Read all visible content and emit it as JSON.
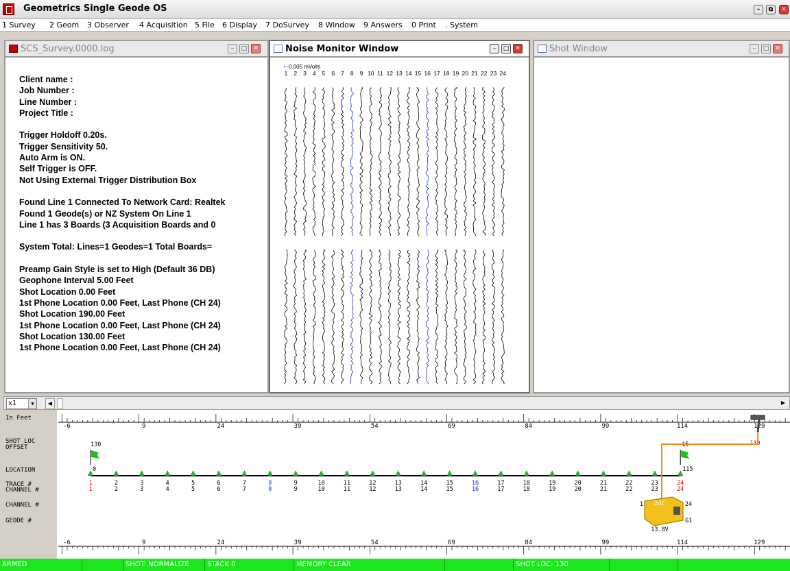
{
  "app": {
    "title": "Geometrics Single Geode OS",
    "controls": {
      "minimize": "–",
      "restore": "⧉",
      "close": "✕"
    }
  },
  "menu": [
    "1 Survey",
    "2 Geom",
    "3 Observer",
    "4 Acquisition",
    "5 File",
    "6 Display",
    "7 DoSurvey",
    "8 Window",
    "9 Answers",
    "0 Print",
    ". System"
  ],
  "windows": {
    "log": {
      "title": "SCS_Survey.0000.log",
      "lines": [
        "Client name  :",
        "Job Number  :",
        "Line Number  :",
        "Project Title  :",
        "",
        "Trigger Holdoff 0.20s.",
        "Trigger Sensitivity 50.",
        "Auto Arm is ON.",
        "Self Trigger is OFF.",
        "Not Using External Trigger Distribution Box",
        "",
        "Found Line 1 Connected To Network Card: Realtek",
        "Found 1 Geode(s) or NZ System On Line 1",
        "Line 1 has 3 Boards (3 Acquisition Boards and 0",
        "",
        "System Total: Lines=1  Geodes=1  Total Boards=",
        "",
        "Preamp Gain Style is set to High (Default 36 DB)",
        "Geophone Interval 5.00 Feet",
        "Shot Location 0.00 Feet",
        "1st Phone Location 0.00 Feet, Last Phone (CH 24)",
        "Shot Location 190.00 Feet",
        "1st Phone Location 0.00 Feet, Last Phone (CH 24)",
        "Shot Location 130.00 Feet",
        "1st Phone Location 0.00 Feet, Last Phone (CH 24)"
      ]
    },
    "noise": {
      "title": "Noise Monitor Window",
      "scale": "0.005 mVolts",
      "channels": [
        "1",
        "2",
        "3",
        "4",
        "5",
        "6",
        "7",
        "8",
        "9",
        "10",
        "11",
        "12",
        "13",
        "14",
        "15",
        "16",
        "17",
        "18",
        "19",
        "20",
        "21",
        "22",
        "23",
        "24"
      ],
      "highlight_channels": [
        "8",
        "16"
      ],
      "colors": {
        "trace": "#000000",
        "highlight": "#2233cc"
      }
    },
    "shot": {
      "title": "Shot Window"
    }
  },
  "geometry": {
    "zoom": "x1",
    "row_labels": {
      "units": "In Feet",
      "shot_loc": "SHOT LOC",
      "offset": "OFFSET",
      "location": "LOCATION",
      "trace": "TRACE #",
      "channel": "CHANNEL #",
      "channel2": "CHANNEL #",
      "geode": "GEODE #"
    },
    "ruler_ticks": [
      "-6",
      "9",
      "24",
      "39",
      "54",
      "69",
      "84",
      "99",
      "114",
      "129"
    ],
    "shot_offset_left": "130",
    "shot_location_left": "0",
    "shot_offset_right": "15",
    "shot_location_right": "115",
    "hammer_offset": "130",
    "traces": [
      "1",
      "2",
      "3",
      "4",
      "5",
      "6",
      "7",
      "8",
      "9",
      "10",
      "11",
      "12",
      "13",
      "14",
      "15",
      "16",
      "17",
      "18",
      "19",
      "20",
      "21",
      "22",
      "23",
      "24"
    ],
    "channels": [
      "1",
      "2",
      "3",
      "4",
      "5",
      "6",
      "7",
      "8",
      "9",
      "10",
      "11",
      "12",
      "13",
      "14",
      "15",
      "16",
      "17",
      "18",
      "19",
      "20",
      "21",
      "22",
      "23",
      "24"
    ],
    "trace_colors": {
      "1": "#dd0000",
      "24": "#dd0000",
      "8": "#2233cc",
      "16": "#2233cc"
    },
    "geode": {
      "label": "24C",
      "left_channel": "1",
      "right_channel": "24",
      "id": "G1",
      "voltage": "13.8V"
    },
    "colors": {
      "flag": "#22c21e",
      "cable": "#f08a1e",
      "geode_body": "#f2c21a"
    }
  },
  "status": [
    {
      "text": "ARMED"
    },
    {
      "text": ""
    },
    {
      "text": "SHOT: NORMALIZE"
    },
    {
      "text": "STACK 0"
    },
    {
      "text": "MEMORY CLEAR"
    },
    {
      "text": ""
    },
    {
      "text": "SHOT LOC: 130"
    },
    {
      "text": ""
    },
    {
      "text": ""
    }
  ]
}
